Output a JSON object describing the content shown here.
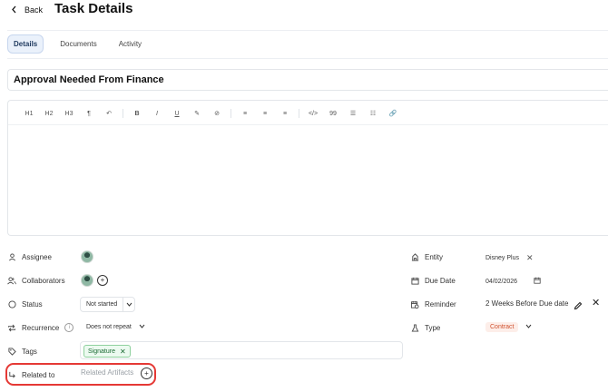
{
  "header": {
    "back_label": "Back",
    "title": "Task Details"
  },
  "tabs": [
    {
      "label": "Details",
      "active": true
    },
    {
      "label": "Documents",
      "active": false
    },
    {
      "label": "Activity",
      "active": false
    }
  ],
  "task": {
    "name": "Approval Needed From Finance"
  },
  "toolbar": [
    "H1",
    "H2",
    "H3",
    "¶",
    "↶",
    "B",
    "I",
    "U",
    "✎",
    "⊘",
    "≡",
    "≡",
    "≡",
    "</>",
    "99",
    "☰",
    "☷",
    "🔗"
  ],
  "fields": {
    "assignee_label": "Assignee",
    "collaborators_label": "Collaborators",
    "status_label": "Status",
    "status_value": "Not started",
    "recurrence_label": "Recurrence",
    "recurrence_value": "Does not repeat",
    "tags_label": "Tags",
    "tag_value": "Signature",
    "related_label": "Related to",
    "related_placeholder": "Related Artifacts",
    "entity_label": "Entity",
    "entity_value": "Disney Plus",
    "due_label": "Due Date",
    "due_value": "04/02/2026",
    "reminder_label": "Reminder",
    "reminder_value": "2 Weeks Before Due date",
    "type_label": "Type",
    "type_value": "Contract"
  },
  "colors": {
    "accent_tab_bg": "#eaf1fb",
    "tag_green": "#1b6b33",
    "contract_orange": "#d0522f",
    "highlight_red": "#e53935"
  },
  "icons": {
    "back": "chevron-left-icon",
    "assignee": "person-icon",
    "collaborators": "people-icon",
    "status": "circle-icon",
    "recurrence": "repeat-icon",
    "tags": "tag-icon",
    "related": "link-arrow-icon",
    "entity": "building-icon",
    "due": "calendar-icon",
    "reminder": "calendar-clock-icon",
    "type": "flask-icon"
  }
}
